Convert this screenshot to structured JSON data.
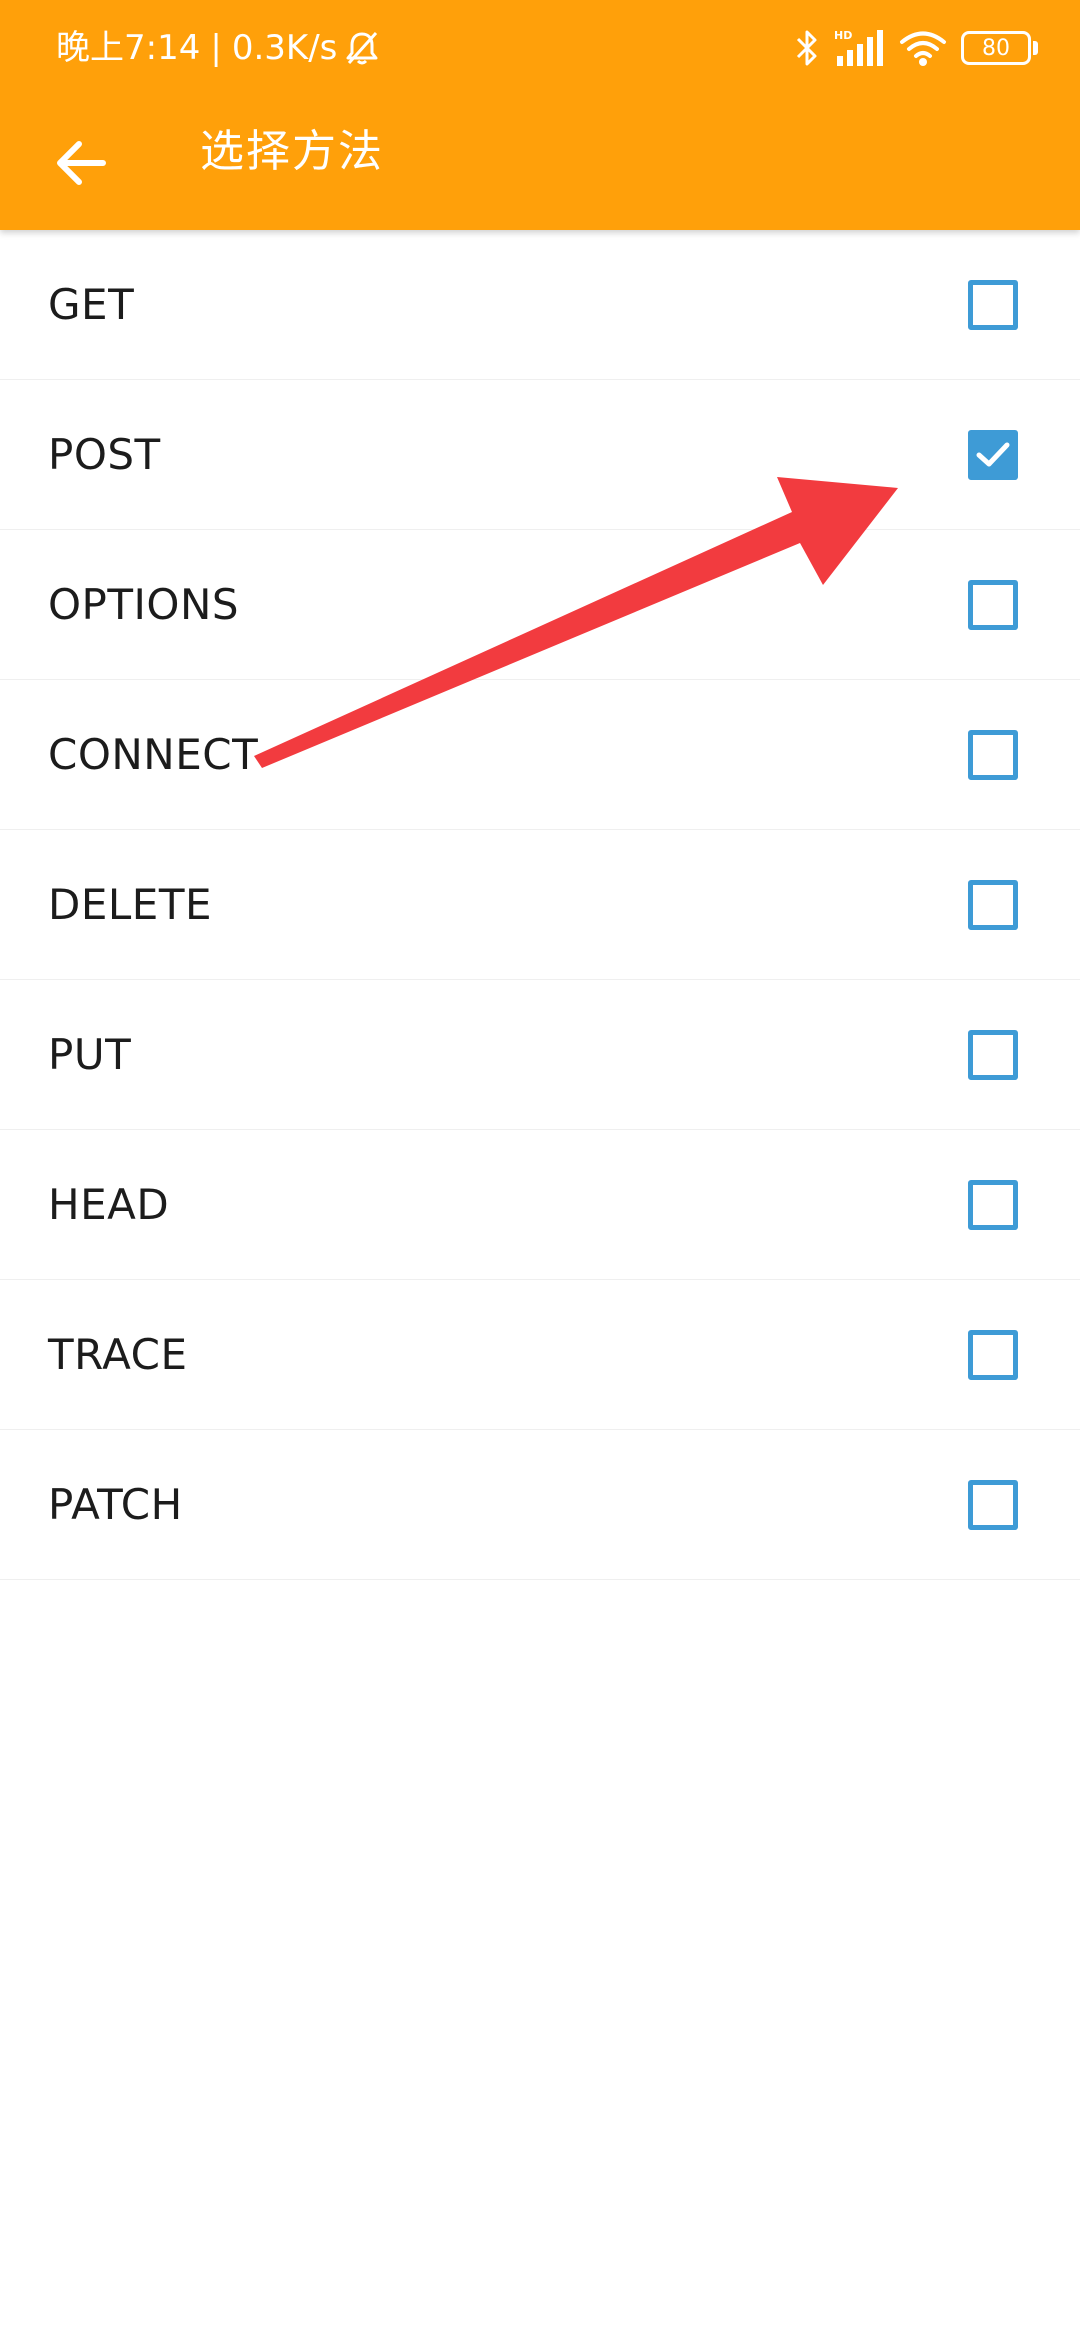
{
  "status_bar": {
    "time": "晚上7:14",
    "separator": "|",
    "network_speed": "0.3K/s",
    "battery_level": "80",
    "icons": [
      "bell-off-icon",
      "bluetooth-icon",
      "hd-signal-icon",
      "wifi-icon",
      "battery-icon"
    ]
  },
  "toolbar": {
    "title": "选择方法",
    "back_icon": "arrow-left-icon"
  },
  "methods": [
    {
      "label": "GET",
      "checked": false
    },
    {
      "label": "POST",
      "checked": true
    },
    {
      "label": "OPTIONS",
      "checked": false
    },
    {
      "label": "CONNECT",
      "checked": false
    },
    {
      "label": "DELETE",
      "checked": false
    },
    {
      "label": "PUT",
      "checked": false
    },
    {
      "label": "HEAD",
      "checked": false
    },
    {
      "label": "TRACE",
      "checked": false
    },
    {
      "label": "PATCH",
      "checked": false
    }
  ],
  "colors": {
    "appbar": "#FFA00A",
    "checkbox": "#3E9BD6",
    "annotation_arrow": "#F23B3F"
  }
}
